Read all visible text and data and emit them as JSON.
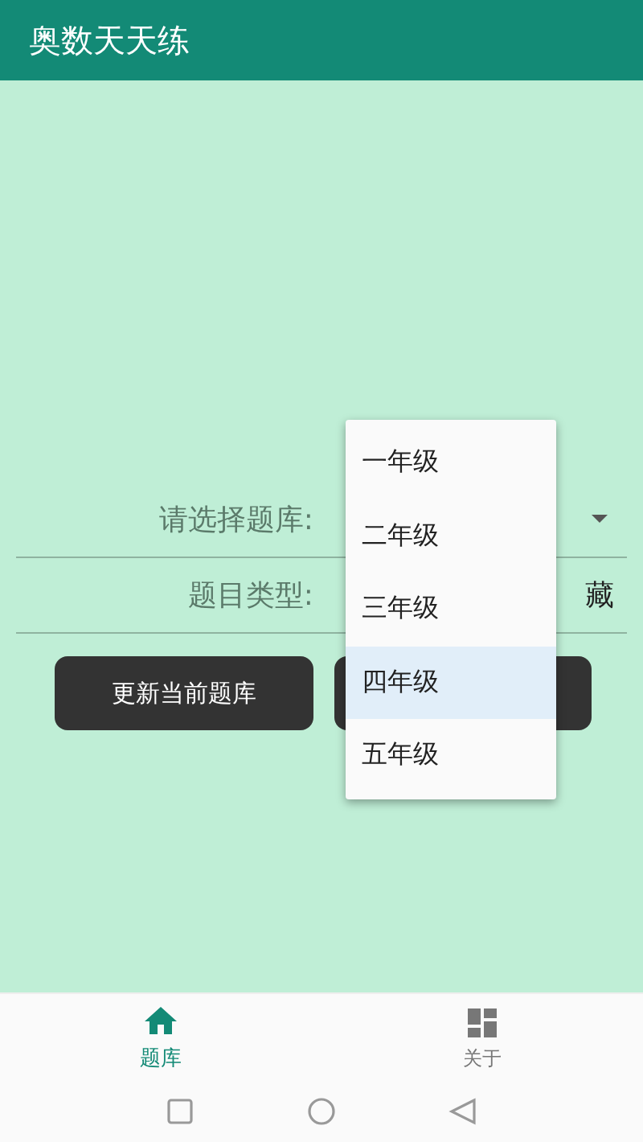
{
  "app_bar": {
    "title": "奥数天天练"
  },
  "form": {
    "bank_label": "请选择题库:",
    "type_label": "题目类型:",
    "type_option_visible": "藏"
  },
  "buttons": [
    {
      "kind": "labeled",
      "label": "更新当前题库"
    },
    {
      "kind": "covered"
    }
  ],
  "dropdown": {
    "items": [
      {
        "label": "一年级",
        "selected": false
      },
      {
        "label": "二年级",
        "selected": false
      },
      {
        "label": "三年级",
        "selected": false
      },
      {
        "label": "四年级",
        "selected": true
      },
      {
        "label": "五年级",
        "selected": false
      }
    ]
  },
  "bottom_nav": [
    {
      "kind": "home",
      "label": "题库",
      "selected": true
    },
    {
      "kind": "grid",
      "label": "关于",
      "selected": false
    }
  ]
}
